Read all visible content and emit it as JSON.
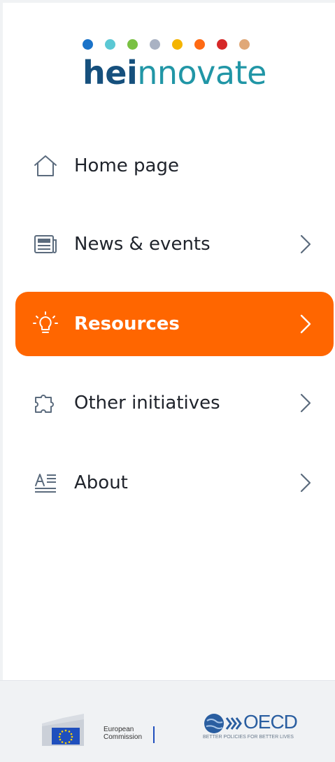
{
  "brand": {
    "name_part1": "hei",
    "name_part2": "nnovate",
    "dot_colors": [
      "#1a73c9",
      "#5bc8d4",
      "#7ac143",
      "#a9b2c3",
      "#f4b400",
      "#ff6a13",
      "#d62828",
      "#e0a878"
    ],
    "color_dark": "#16507d",
    "color_light": "#2196a6"
  },
  "nav": {
    "items": [
      {
        "label": "Home page",
        "icon": "home-icon",
        "has_chevron": false,
        "active": false
      },
      {
        "label": "News & events",
        "icon": "newspaper-icon",
        "has_chevron": true,
        "active": false
      },
      {
        "label": "Resources",
        "icon": "lightbulb-icon",
        "has_chevron": true,
        "active": true
      },
      {
        "label": "Other initiatives",
        "icon": "puzzle-icon",
        "has_chevron": true,
        "active": false
      },
      {
        "label": "About",
        "icon": "text-document-icon",
        "has_chevron": true,
        "active": false
      }
    ],
    "active_color": "#ff6600",
    "icon_color": "#5b6b7d"
  },
  "footer": {
    "ec_text": "European\nCommission",
    "oecd_word": "OECD",
    "oecd_tagline": "BETTER POLICIES FOR BETTER LIVES"
  }
}
